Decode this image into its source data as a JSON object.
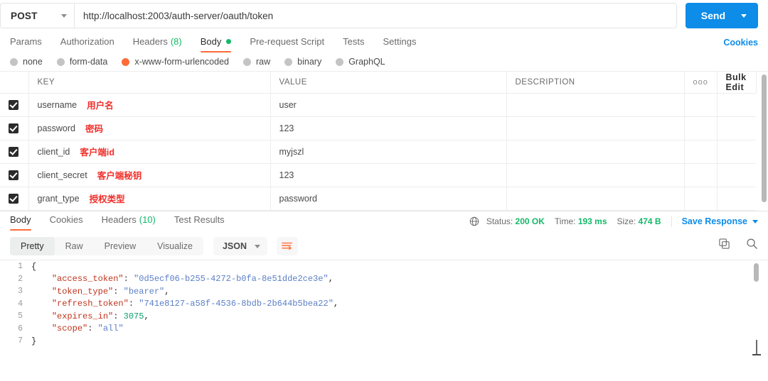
{
  "request": {
    "method": "POST",
    "url": "http://localhost:2003/auth-server/oauth/token",
    "send_label": "Send",
    "tabs": [
      {
        "label": "Params",
        "active": false,
        "badge": ""
      },
      {
        "label": "Authorization",
        "active": false,
        "badge": ""
      },
      {
        "label": "Headers",
        "active": false,
        "badge": "(8)"
      },
      {
        "label": "Body",
        "active": true,
        "badge": ""
      },
      {
        "label": "Pre-request Script",
        "active": false,
        "badge": ""
      },
      {
        "label": "Tests",
        "active": false,
        "badge": ""
      },
      {
        "label": "Settings",
        "active": false,
        "badge": ""
      }
    ],
    "cookies_link": "Cookies",
    "body_types": [
      {
        "label": "none",
        "selected": false
      },
      {
        "label": "form-data",
        "selected": false
      },
      {
        "label": "x-www-form-urlencoded",
        "selected": true
      },
      {
        "label": "raw",
        "selected": false
      },
      {
        "label": "binary",
        "selected": false
      },
      {
        "label": "GraphQL",
        "selected": false
      }
    ]
  },
  "table": {
    "headers": {
      "key": "KEY",
      "value": "VALUE",
      "description": "DESCRIPTION",
      "more": "ooo",
      "bulk_edit": "Bulk Edit"
    },
    "rows": [
      {
        "checked": true,
        "key": "username",
        "key_note": "用户名",
        "value": "user",
        "description": ""
      },
      {
        "checked": true,
        "key": "password",
        "key_note": "密码",
        "value": "123",
        "description": ""
      },
      {
        "checked": true,
        "key": "client_id",
        "key_note": "客户端id",
        "value": "myjszl",
        "description": ""
      },
      {
        "checked": true,
        "key": "client_secret",
        "key_note": "客户端秘钥",
        "value": "123",
        "description": ""
      },
      {
        "checked": true,
        "key": "grant_type",
        "key_note": "授权类型",
        "value": "password",
        "description": ""
      }
    ]
  },
  "response": {
    "tabs": [
      {
        "label": "Body",
        "active": true,
        "badge": ""
      },
      {
        "label": "Cookies",
        "active": false,
        "badge": ""
      },
      {
        "label": "Headers",
        "active": false,
        "badge": "(10)"
      },
      {
        "label": "Test Results",
        "active": false,
        "badge": ""
      }
    ],
    "status_label": "Status:",
    "status_value": "200 OK",
    "time_label": "Time:",
    "time_value": "193 ms",
    "size_label": "Size:",
    "size_value": "474 B",
    "save_response": "Save Response",
    "view_modes": [
      {
        "label": "Pretty",
        "active": true
      },
      {
        "label": "Raw",
        "active": false
      },
      {
        "label": "Preview",
        "active": false
      },
      {
        "label": "Visualize",
        "active": false
      }
    ],
    "format": "JSON",
    "body_lines": [
      {
        "n": "1",
        "segments": [
          {
            "t": "{",
            "c": "p"
          }
        ]
      },
      {
        "n": "2",
        "segments": [
          {
            "t": "    ",
            "c": "p"
          },
          {
            "t": "\"access_token\"",
            "c": "k"
          },
          {
            "t": ": ",
            "c": "p"
          },
          {
            "t": "\"0d5ecf06-b255-4272-b0fa-8e51dde2ce3e\"",
            "c": "s"
          },
          {
            "t": ",",
            "c": "p"
          }
        ]
      },
      {
        "n": "3",
        "segments": [
          {
            "t": "    ",
            "c": "p"
          },
          {
            "t": "\"token_type\"",
            "c": "k"
          },
          {
            "t": ": ",
            "c": "p"
          },
          {
            "t": "\"bearer\"",
            "c": "s"
          },
          {
            "t": ",",
            "c": "p"
          }
        ]
      },
      {
        "n": "4",
        "segments": [
          {
            "t": "    ",
            "c": "p"
          },
          {
            "t": "\"refresh_token\"",
            "c": "k"
          },
          {
            "t": ": ",
            "c": "p"
          },
          {
            "t": "\"741e8127-a58f-4536-8bdb-2b644b5bea22\"",
            "c": "s"
          },
          {
            "t": ",",
            "c": "p"
          }
        ]
      },
      {
        "n": "5",
        "segments": [
          {
            "t": "    ",
            "c": "p"
          },
          {
            "t": "\"expires_in\"",
            "c": "k"
          },
          {
            "t": ": ",
            "c": "p"
          },
          {
            "t": "3075",
            "c": "n"
          },
          {
            "t": ",",
            "c": "p"
          }
        ]
      },
      {
        "n": "6",
        "segments": [
          {
            "t": "    ",
            "c": "p"
          },
          {
            "t": "\"scope\"",
            "c": "k"
          },
          {
            "t": ": ",
            "c": "p"
          },
          {
            "t": "\"all\"",
            "c": "s"
          }
        ]
      },
      {
        "n": "7",
        "segments": [
          {
            "t": "}",
            "c": "p"
          }
        ]
      }
    ],
    "parsed_body": {
      "access_token": "0d5ecf06-b255-4272-b0fa-8e51dde2ce3e",
      "token_type": "bearer",
      "refresh_token": "741e8127-a58f-4536-8bdb-2b644b5bea22",
      "expires_in": 3075,
      "scope": "all"
    }
  },
  "colors": {
    "accent_orange": "#ff6c37",
    "link_blue": "#0d8ce8",
    "success_green": "#13b968",
    "note_red": "#f1302b"
  }
}
